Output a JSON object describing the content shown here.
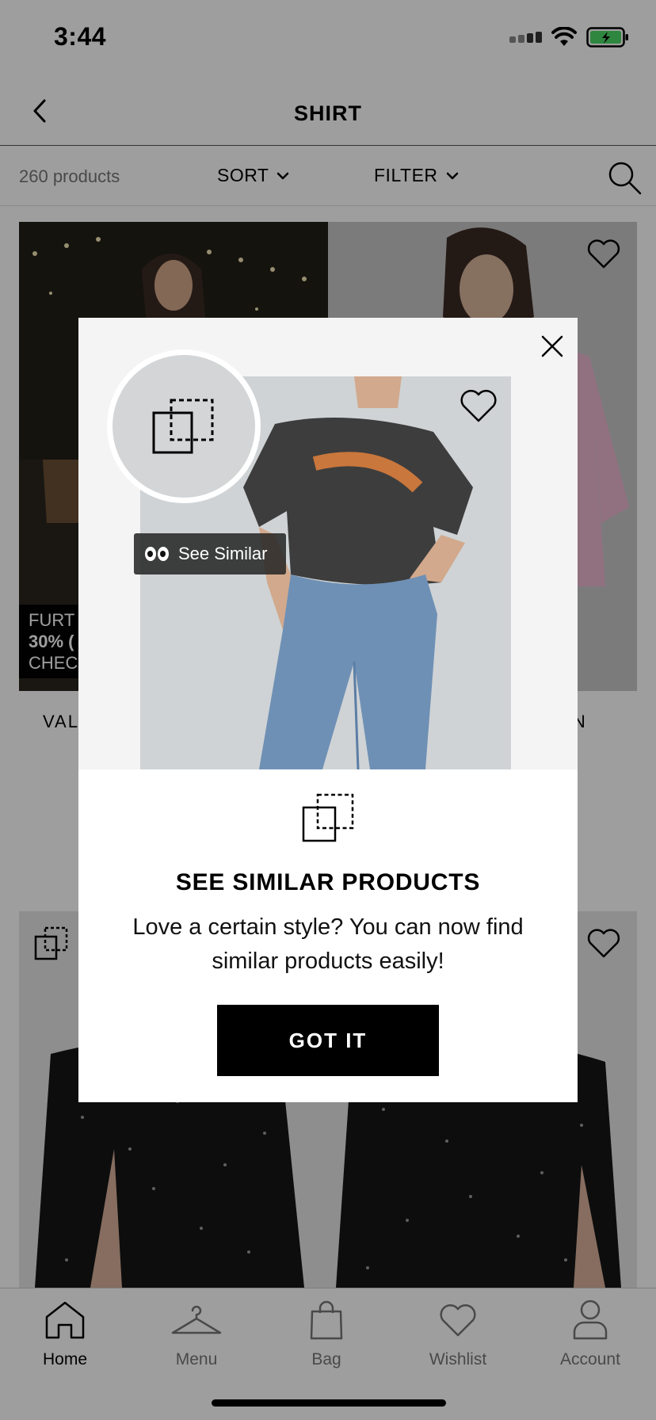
{
  "status_bar": {
    "time": "3:44"
  },
  "header": {
    "title": "SHIRT"
  },
  "toolbar": {
    "product_count": "260 products",
    "sort_label": "SORT",
    "filter_label": "FILTER"
  },
  "products": [
    {
      "name": "VAL",
      "promo_line1": "FURT",
      "promo_line2": "30% (",
      "promo_line3": "CHEC"
    },
    {
      "name": "S IN"
    },
    {
      "name": ""
    },
    {
      "name": ""
    }
  ],
  "modal": {
    "tag_label": "See Similar",
    "heading": "SEE SIMILAR PRODUCTS",
    "text": "Love a certain style? You can now find similar products easily!",
    "button_label": "GOT IT"
  },
  "tabbar": {
    "items": [
      {
        "label": "Home",
        "icon": "home-icon",
        "active": true
      },
      {
        "label": "Menu",
        "icon": "hanger-icon"
      },
      {
        "label": "Bag",
        "icon": "bag-icon"
      },
      {
        "label": "Wishlist",
        "icon": "heart-icon"
      },
      {
        "label": "Account",
        "icon": "person-icon"
      }
    ]
  },
  "colors": {
    "overlay": "#000000",
    "accent": "#000000",
    "battery": "#4cd964"
  }
}
